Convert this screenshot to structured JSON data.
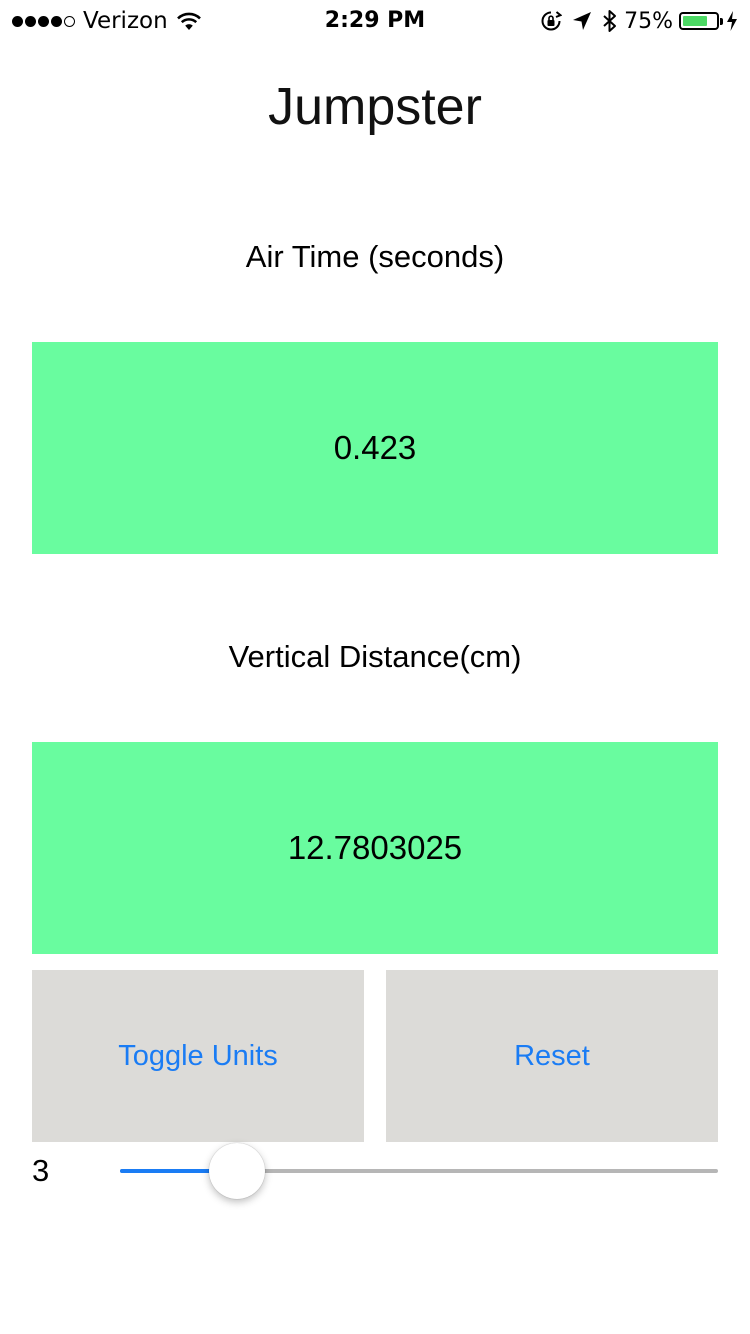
{
  "status_bar": {
    "carrier": "Verizon",
    "signal_bars_filled": 4,
    "signal_bars_total": 5,
    "time": "2:29 PM",
    "battery_percent_label": "75%",
    "battery_level": 0.75,
    "icons": [
      "wifi-icon",
      "orientation-lock-icon",
      "location-arrow-icon",
      "bluetooth-icon",
      "battery-icon",
      "charging-bolt-icon"
    ]
  },
  "app": {
    "title": "Jumpster"
  },
  "air_time": {
    "label": "Air Time (seconds)",
    "value": "0.423"
  },
  "vertical_distance": {
    "label": "Vertical Distance(cm)",
    "value": "12.7803025"
  },
  "buttons": {
    "toggle_units": "Toggle Units",
    "reset": "Reset"
  },
  "slider": {
    "value_label": "3",
    "fraction": 0.195
  },
  "colors": {
    "value_box": "#69fc9f",
    "button_bg": "#dcdbd8",
    "accent": "#1a7cf4",
    "battery": "#4cd964"
  }
}
